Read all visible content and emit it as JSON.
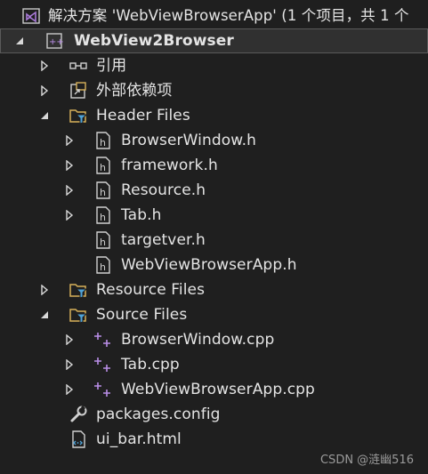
{
  "solution": {
    "label": "解决方案 'WebViewBrowserApp' (1 个项目，共 1 个"
  },
  "project": {
    "label": "WebView2Browser"
  },
  "nodes": {
    "references": "引用",
    "external_deps": "外部依赖项",
    "header_files": "Header Files",
    "browserwindow_h": "BrowserWindow.h",
    "framework_h": "framework.h",
    "resource_h": "Resource.h",
    "tab_h": "Tab.h",
    "targetver_h": "targetver.h",
    "webviewbrowserapp_h": "WebViewBrowserApp.h",
    "resource_files": "Resource Files",
    "source_files": "Source Files",
    "browserwindow_cpp": "BrowserWindow.cpp",
    "tab_cpp": "Tab.cpp",
    "webviewbrowserapp_cpp": "WebViewBrowserApp.cpp",
    "packages_config": "packages.config",
    "ui_bar_html": "ui_bar.html"
  },
  "watermark": "CSDN @涟幽516",
  "colors": {
    "background": "#1f1f1f",
    "text": "#e4e4e4",
    "vs_purple": "#a97ad8",
    "folder_yellow": "#d7b15a",
    "filter_blue": "#4fa3d8",
    "cpp_purple": "#b98de6"
  },
  "icons": {
    "solution": "visual-studio-solution-icon",
    "project": "cpp-project-icon",
    "references": "references-icon",
    "external_deps": "external-dependencies-icon",
    "filter": "filter-folder-icon",
    "header": "header-file-icon",
    "cpp": "cpp-file-icon",
    "config": "config-wrench-icon",
    "html": "html-file-icon"
  }
}
